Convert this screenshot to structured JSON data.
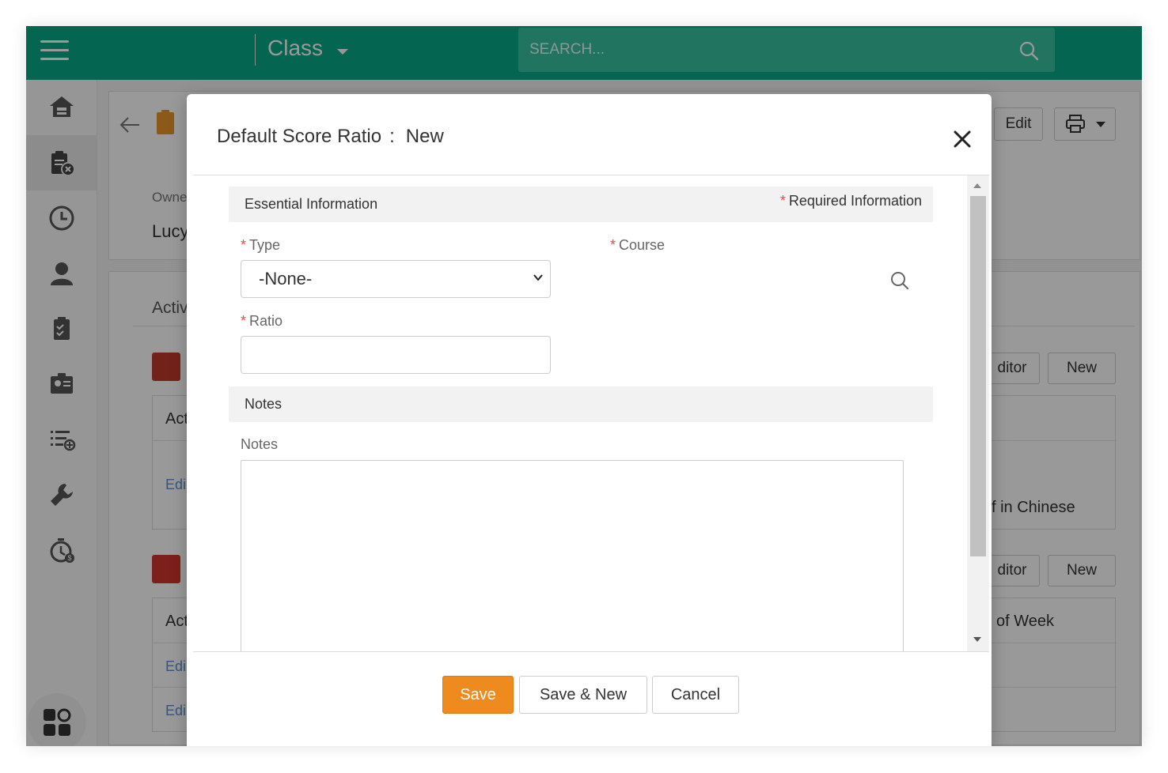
{
  "topbar": {
    "module_title": "Class",
    "search_placeholder": "SEARCH..."
  },
  "background": {
    "edit_label": "Edit",
    "owner_label": "Owne",
    "owner_value": "Lucy",
    "activities_label": "Activ",
    "editor_label_1": "ditor",
    "new_label_1": "New",
    "table1_header": "Act",
    "table1_row": "Edi",
    "table1_cell_right": "f in Chinese",
    "editor_label_2": "ditor",
    "new_label_2": "New",
    "table2_header": "Act",
    "table2_cell_right": "of Week",
    "table2_row1": "Edi",
    "table2_row2": "Edi"
  },
  "modal": {
    "title": "Default Score Ratio",
    "separator": ":",
    "mode": "New",
    "section_essential": "Essential Information",
    "required_info": "Required Information",
    "type_label": "Type",
    "type_value": "-None-",
    "course_label": "Course",
    "ratio_label": "Ratio",
    "ratio_value": "",
    "section_notes": "Notes",
    "notes_label": "Notes",
    "notes_value": ""
  },
  "footer": {
    "save_label": "Save",
    "save_new_label": "Save & New",
    "cancel_label": "Cancel"
  },
  "colors": {
    "brand": "#08a987",
    "save_button": "#ee8a1e",
    "required_star": "#e34d4d"
  }
}
